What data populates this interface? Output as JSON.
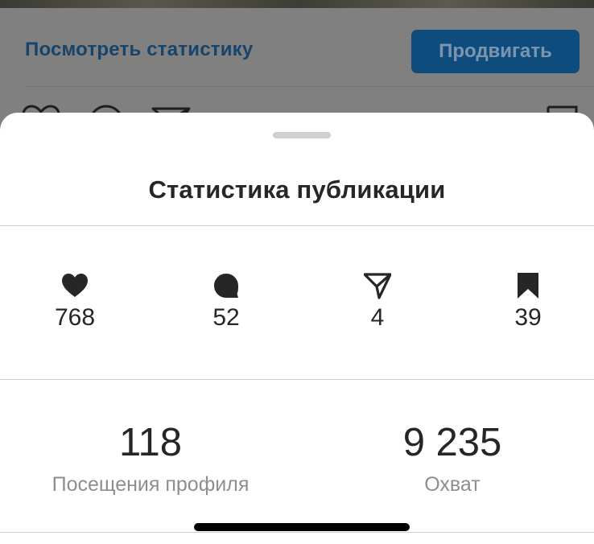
{
  "background_post": {
    "stats_link": "Посмотреть статистику",
    "promote_button": "Продвигать"
  },
  "sheet": {
    "title": "Статистика публикации",
    "metrics": [
      {
        "icon": "heart-icon",
        "value": "768"
      },
      {
        "icon": "comment-icon",
        "value": "52"
      },
      {
        "icon": "send-icon",
        "value": "4"
      },
      {
        "icon": "bookmark-icon",
        "value": "39"
      }
    ],
    "summary": [
      {
        "value": "118",
        "label": "Посещения профиля"
      },
      {
        "value": "9 235",
        "label": "Охват"
      }
    ]
  },
  "colors": {
    "overlay_gray": "#7d7d7d",
    "link_blue_dimmed": "#17446a",
    "button_blue_dimmed": "#0f4c7e",
    "text_primary": "#262626",
    "text_secondary": "#8e8e8e",
    "divider": "#cfcfcf"
  }
}
